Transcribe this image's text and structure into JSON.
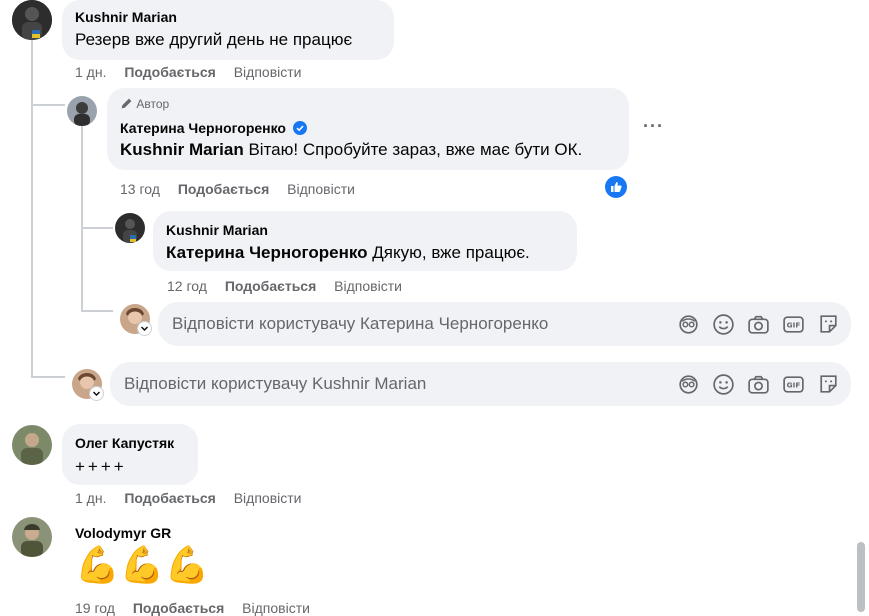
{
  "comments": [
    {
      "author": "Kushnir Marian",
      "text": "Резерв вже другий день не працює",
      "time": "1 дн.",
      "like_label": "Подобається",
      "reply_label": "Відповісти"
    },
    {
      "author_badge": "Автор",
      "author": "Катерина Черногоренко",
      "mention": "Kushnir Marian",
      "text": " Вітаю! Спробуйте зараз, вже має бути ОК.",
      "time": "13 год",
      "like_label": "Подобається",
      "reply_label": "Відповісти",
      "more_label": "···"
    },
    {
      "author": "Kushnir Marian",
      "mention": "Катерина Черногоренко",
      "text": " Дякую, вже працює.",
      "time": "12 год",
      "like_label": "Подобається",
      "reply_label": "Відповісти"
    },
    {
      "author": "Олег Капустяк",
      "text": "++++",
      "time": "1 дн.",
      "like_label": "Подобається",
      "reply_label": "Відповісти"
    },
    {
      "author": "Volodymyr GR",
      "text": "💪💪💪",
      "time": "19 год",
      "like_label": "Подобається",
      "reply_label": "Відповісти"
    }
  ],
  "reply_inputs": {
    "nested_placeholder": "Відповісти користувачу Катерина Черногоренко",
    "thread_placeholder": "Відповісти користувачу Kushnir Marian"
  },
  "colors": {
    "bubble": "#f0f2f5",
    "meta": "#65676b",
    "like_blue": "#1877f2",
    "thread_line": "#ccd0d5"
  }
}
